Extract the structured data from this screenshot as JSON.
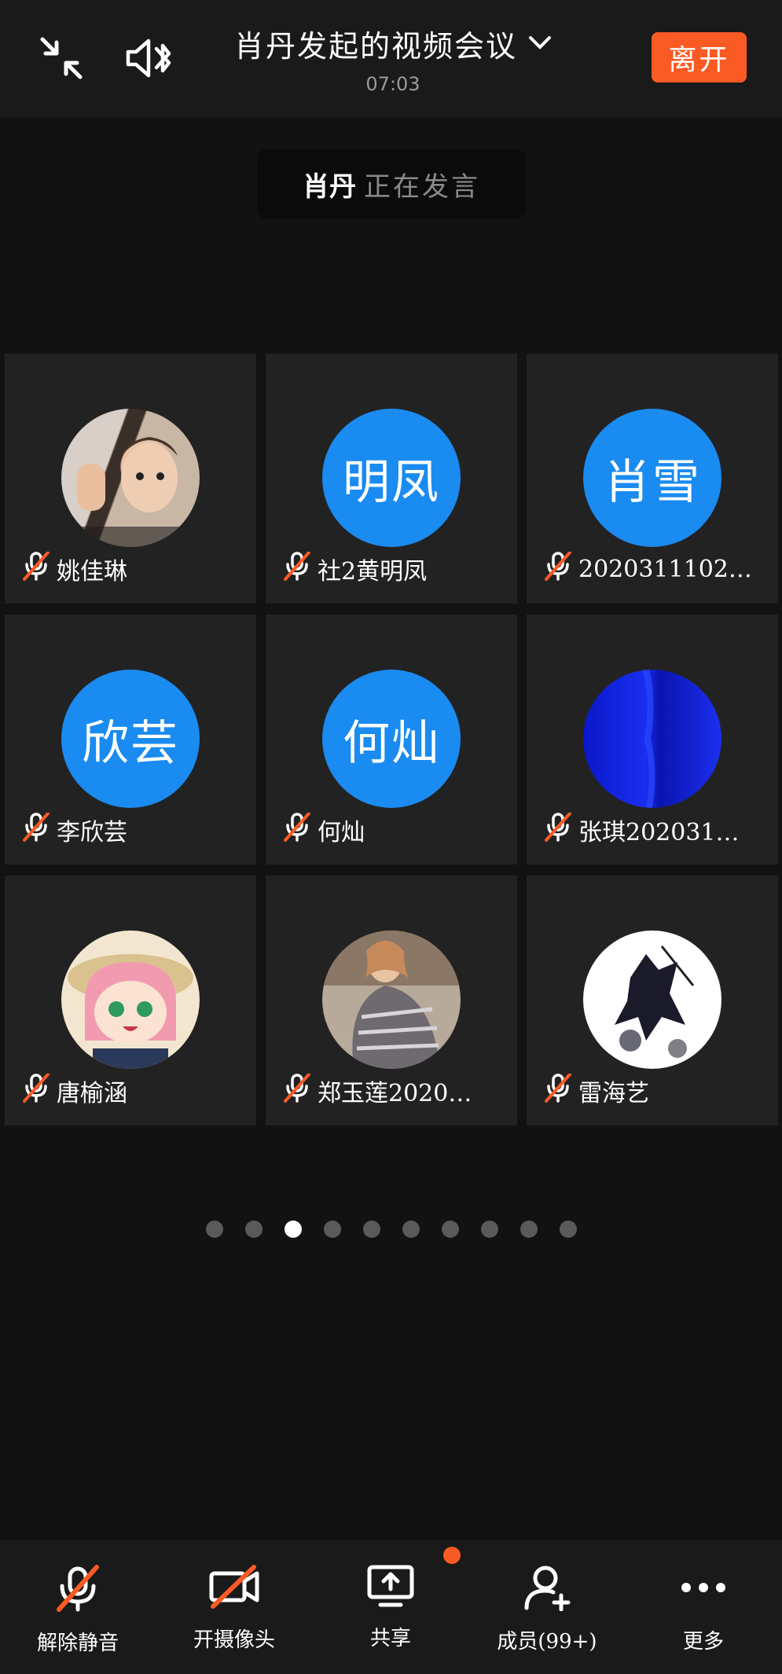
{
  "header": {
    "title": "肖丹发起的视频会议",
    "timer": "07:03",
    "leave_label": "离开"
  },
  "speaking": {
    "name": "肖丹",
    "status": "正在发言"
  },
  "participants": [
    {
      "name": "姚佳琳",
      "avatar_text": "",
      "avatar_kind": "photo-child"
    },
    {
      "name": "社2黄明凤",
      "avatar_text": "明凤",
      "avatar_kind": "text"
    },
    {
      "name": "2020311102…",
      "avatar_text": "肖雪",
      "avatar_kind": "text"
    },
    {
      "name": "李欣芸",
      "avatar_text": "欣芸",
      "avatar_kind": "text"
    },
    {
      "name": "何灿",
      "avatar_text": "何灿",
      "avatar_kind": "text"
    },
    {
      "name": "张琪202031…",
      "avatar_text": "",
      "avatar_kind": "photo-blue"
    },
    {
      "name": "唐榆涵",
      "avatar_text": "",
      "avatar_kind": "photo-anime"
    },
    {
      "name": "郑玉莲2020…",
      "avatar_text": "",
      "avatar_kind": "photo-woman"
    },
    {
      "name": "雷海艺",
      "avatar_text": "",
      "avatar_kind": "photo-ink"
    }
  ],
  "pagination": {
    "total": 10,
    "current": 3
  },
  "toolbar": {
    "unmute": "解除静音",
    "camera": "开摄像头",
    "share": "共享",
    "members": "成员(99+)",
    "more": "更多"
  },
  "colors": {
    "accent": "#fa5a24",
    "avatar_blue": "#1a8bf0",
    "tile_bg": "#222222"
  },
  "icons": [
    "collapse-icon",
    "speaker-bluetooth-icon",
    "chevron-down-icon",
    "mic-muted-icon",
    "camera-off-icon",
    "share-screen-icon",
    "add-member-icon",
    "more-icon"
  ]
}
